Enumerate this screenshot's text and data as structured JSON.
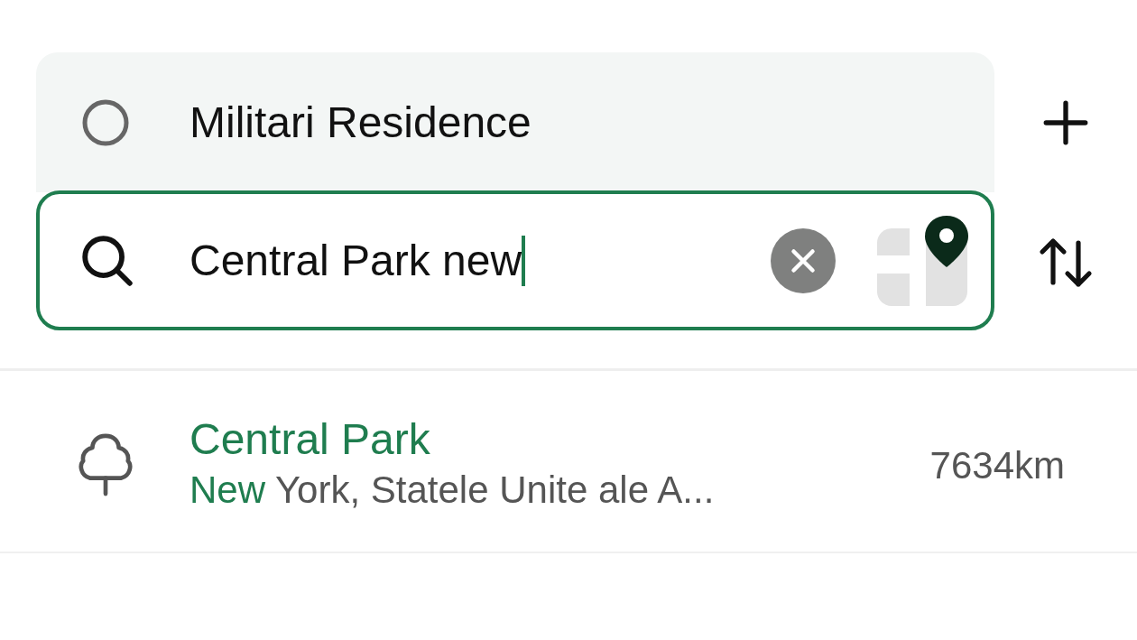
{
  "origin": {
    "value": "Militari Residence"
  },
  "destination": {
    "value": "Central Park new",
    "focused": true
  },
  "results": [
    {
      "title": "Central Park",
      "subtitle_match": "New",
      "subtitle_rest": "York, Statele Unite ale A...",
      "distance": "7634km"
    }
  ]
}
